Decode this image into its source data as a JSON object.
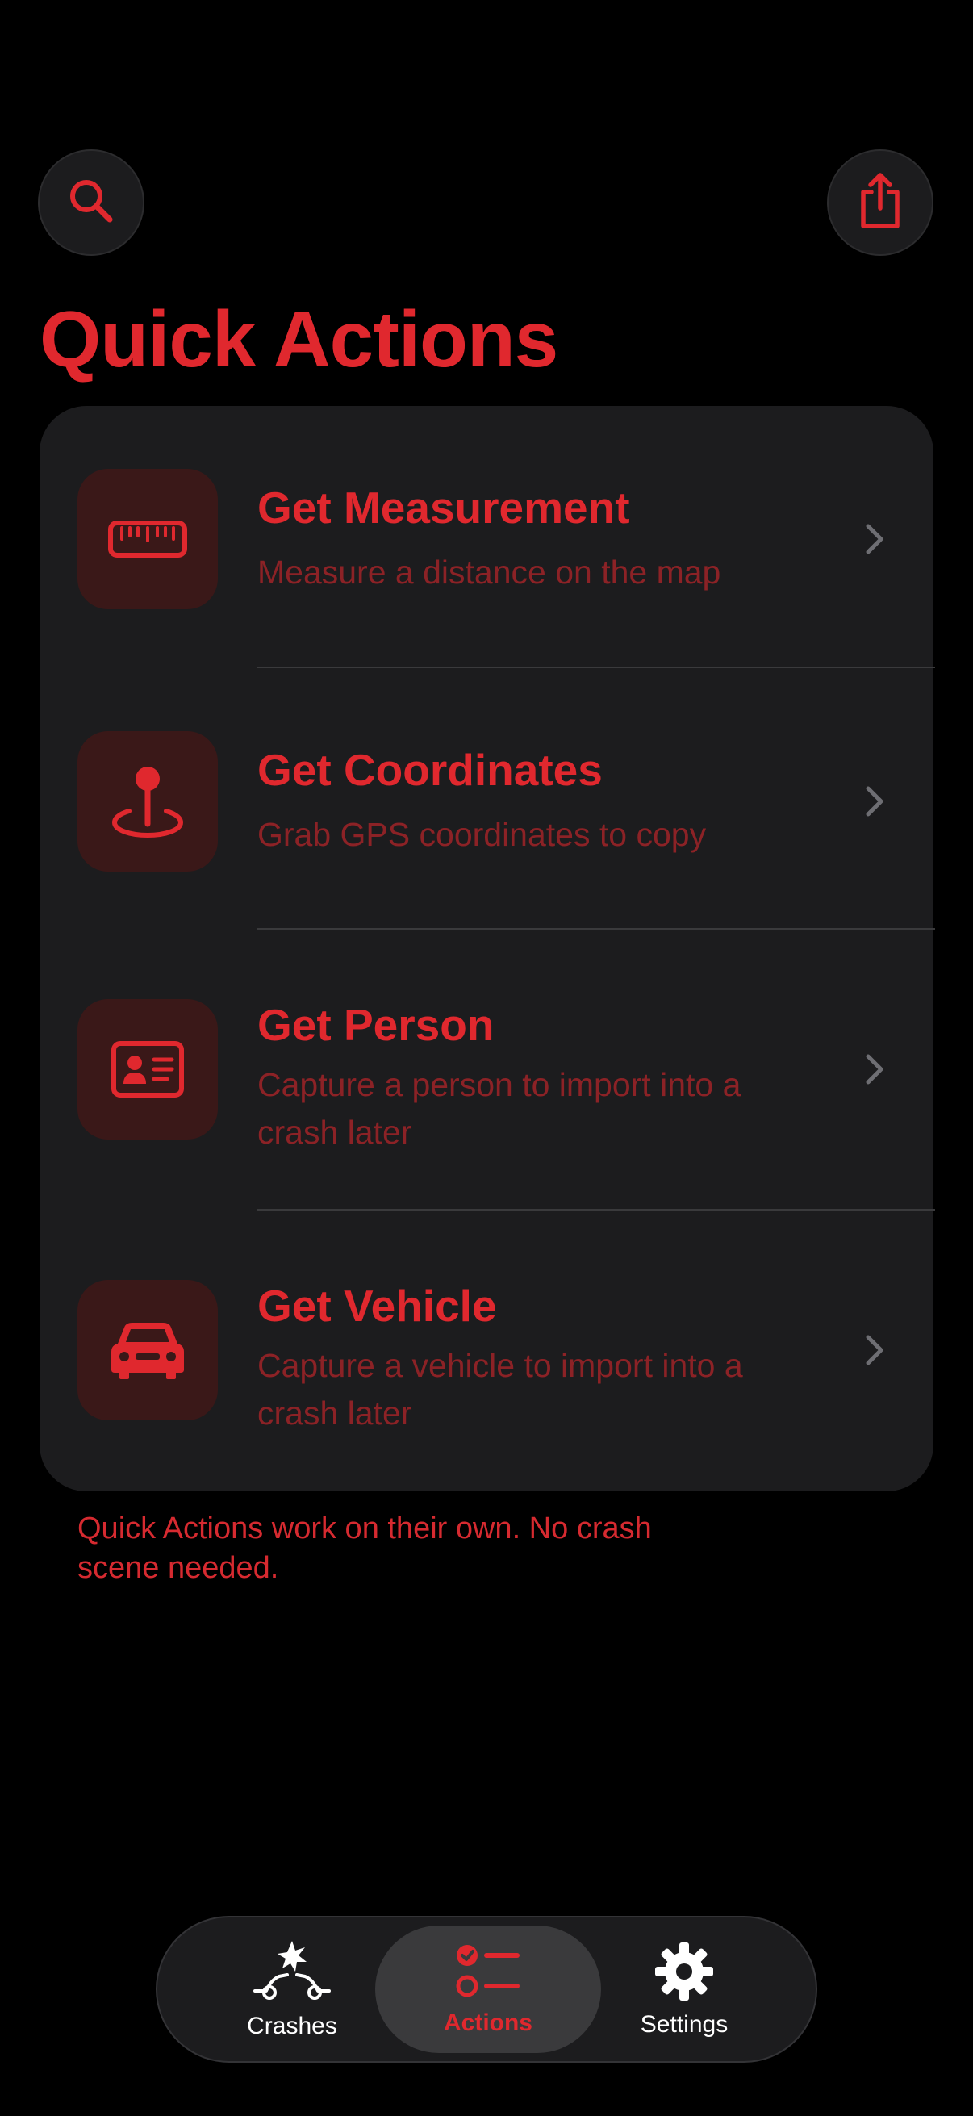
{
  "header": {
    "search_icon": "search-icon",
    "share_icon": "share-icon",
    "title": "Quick Actions"
  },
  "actions": [
    {
      "title": "Get Measurement",
      "subtitle": "Measure a distance on the map",
      "icon": "ruler-icon"
    },
    {
      "title": "Get Coordinates",
      "subtitle": "Grab GPS coordinates to copy",
      "icon": "map-pin-icon"
    },
    {
      "title": "Get Person",
      "subtitle": "Capture a person to import into a crash later",
      "icon": "id-card-icon"
    },
    {
      "title": "Get Vehicle",
      "subtitle": "Capture a vehicle to import into a crash later",
      "icon": "car-icon"
    }
  ],
  "footer_note": "Quick Actions work on their own. No crash scene needed.",
  "tabbar": {
    "tabs": [
      {
        "label": "Crashes",
        "icon": "crash-icon",
        "active": false
      },
      {
        "label": "Actions",
        "icon": "checklist-icon",
        "active": true
      },
      {
        "label": "Settings",
        "icon": "gear-icon",
        "active": false
      }
    ]
  },
  "colors": {
    "accent": "#e0282e",
    "background": "#000000",
    "card": "#1c1c1e",
    "subtitle": "#8c2226",
    "icon_tile": "#3a1818"
  }
}
